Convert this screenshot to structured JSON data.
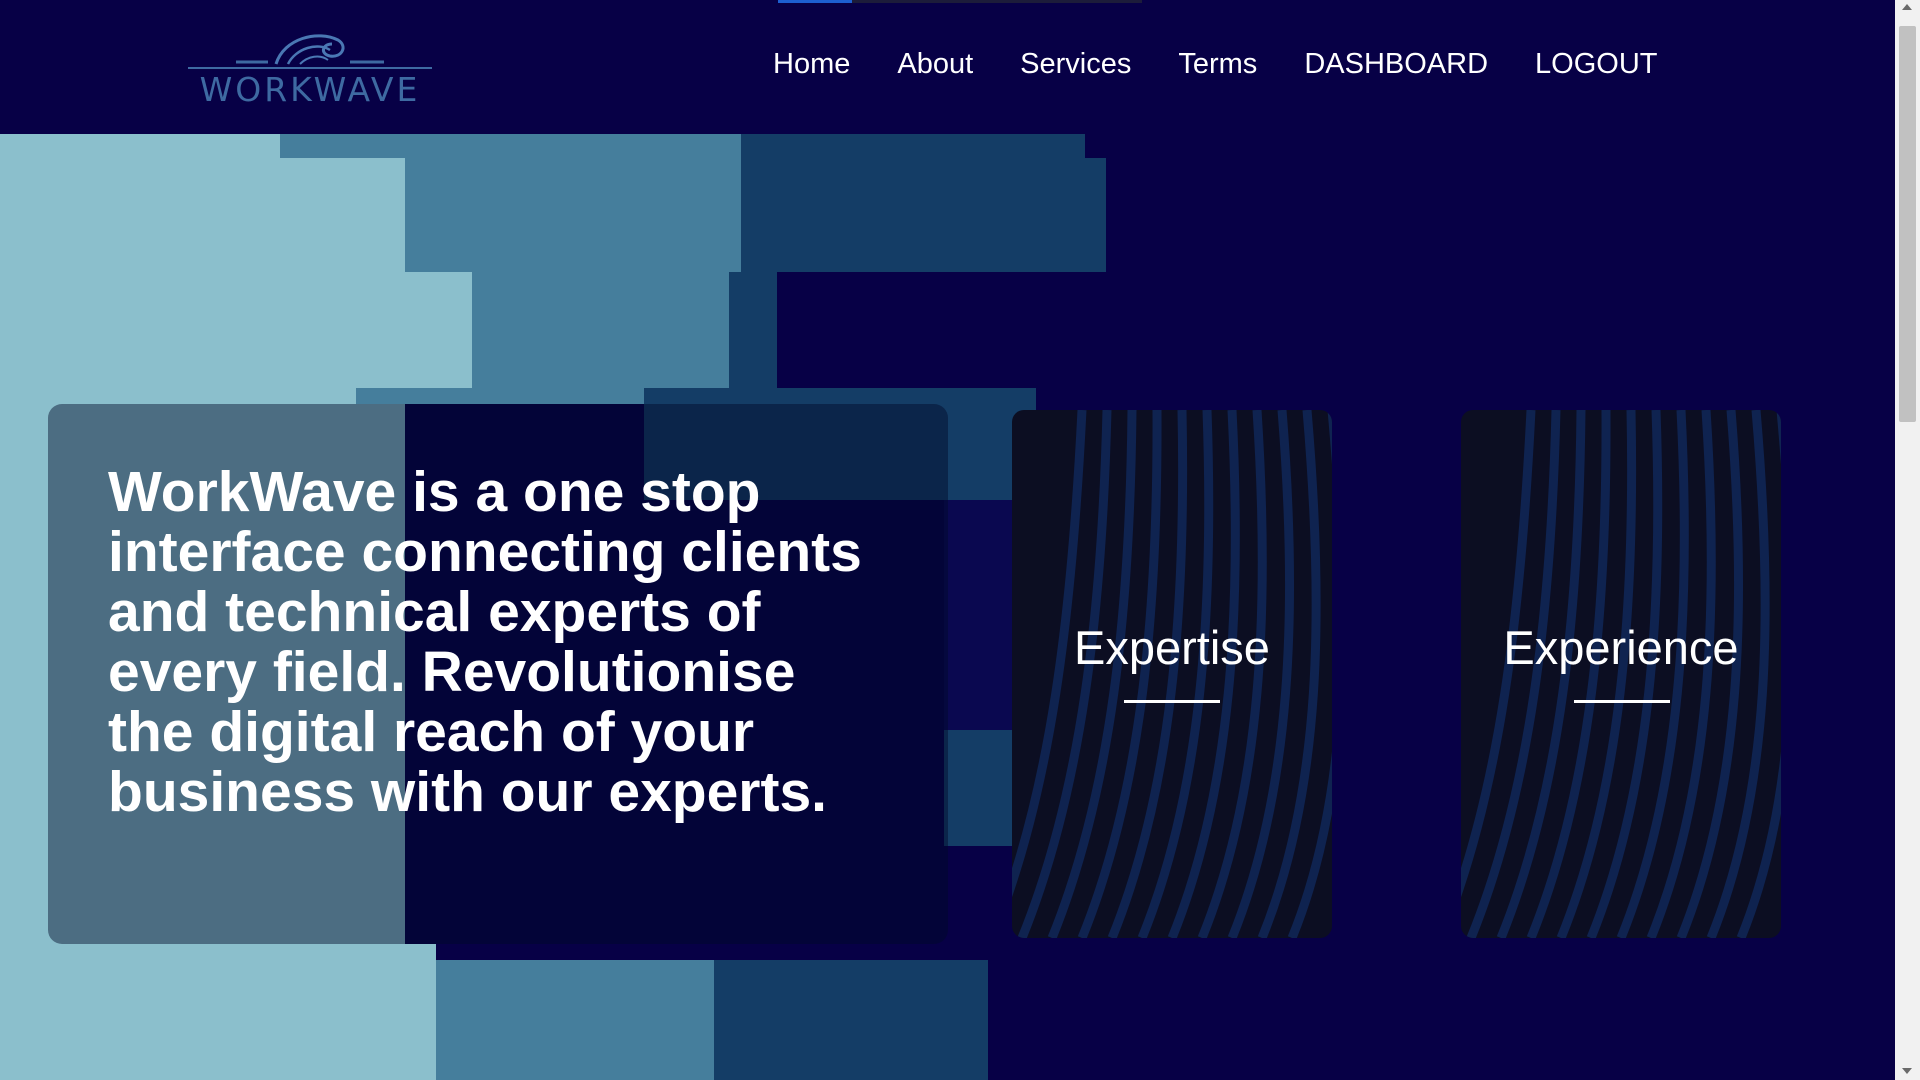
{
  "brand": {
    "name": "WORKWAVE"
  },
  "nav": {
    "items": [
      "Home",
      "About",
      "Services",
      "Terms",
      "DASHBOARD",
      "LOGOUT"
    ]
  },
  "hero": {
    "text": "WorkWave is a one stop interface connecting clients and technical experts of every field. Revolutionise the digital reach of your business with our experts."
  },
  "cards": [
    {
      "title": "Expertise"
    },
    {
      "title": "Experience"
    }
  ],
  "colors": {
    "background": "#070046",
    "light_block": "#8bbfcc",
    "mid_block": "#457e9c",
    "dark_block": "#143d66",
    "logo": "#3e6aa2"
  }
}
